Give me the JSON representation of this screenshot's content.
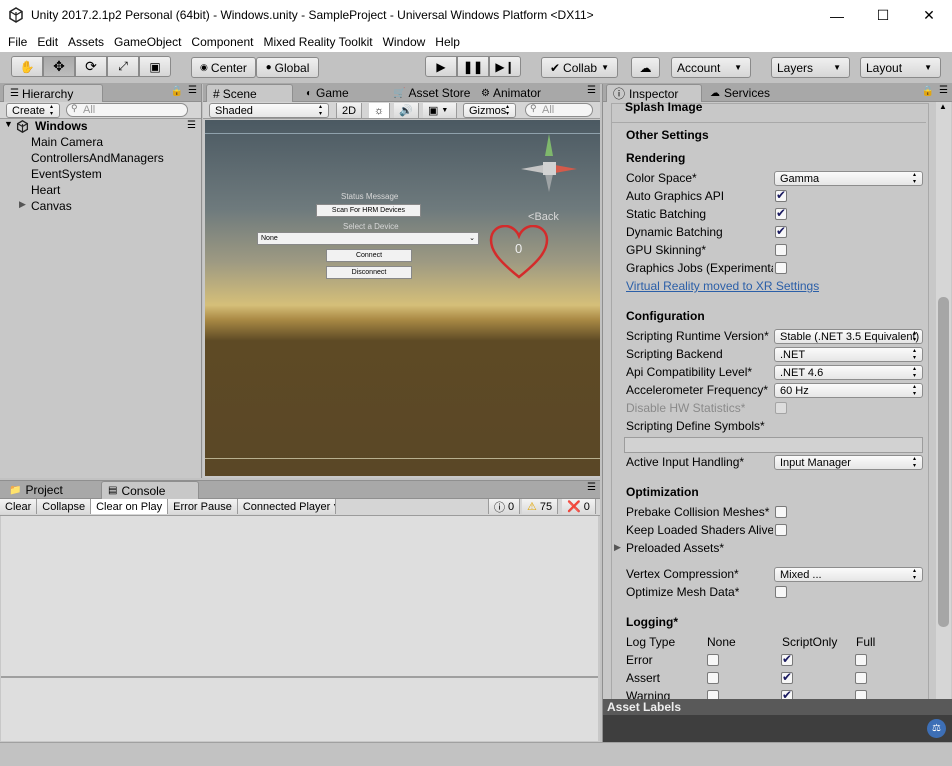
{
  "window": {
    "title": "Unity 2017.2.1p2 Personal (64bit) - Windows.unity - SampleProject - Universal Windows Platform <DX11>",
    "min": "—",
    "max": "☐",
    "close": "✕"
  },
  "menu": [
    "File",
    "Edit",
    "Assets",
    "GameObject",
    "Component",
    "Mixed Reality Toolkit",
    "Window",
    "Help"
  ],
  "toolbar": {
    "center": "Center",
    "global": "Global",
    "collab": "Collab",
    "account": "Account",
    "layers": "Layers",
    "layout": "Layout"
  },
  "hierarchy": {
    "tab": "Hierarchy",
    "create": "Create",
    "search_placeholder": "All",
    "scene": "Windows",
    "items": [
      "Main Camera",
      "ControllersAndManagers",
      "EventSystem",
      "Heart",
      "Canvas"
    ]
  },
  "scene_tabs": {
    "scene": "Scene",
    "game": "Game",
    "asset_store": "Asset Store",
    "animator": "Animator"
  },
  "scene_toolbar": {
    "shaded": "Shaded",
    "two_d": "2D",
    "gizmos": "Gizmos",
    "search_placeholder": "All"
  },
  "scene_view": {
    "status": "Status Message",
    "scan_button": "Scan For HRM Devices",
    "select_label": "Select a Device",
    "select_value": "None",
    "connect": "Connect",
    "disconnect": "Disconnect",
    "heart_value": "0",
    "back": "Back"
  },
  "bottom_tabs": {
    "project": "Project",
    "console": "Console"
  },
  "console_toolbar": {
    "clear": "Clear",
    "collapse": "Collapse",
    "clear_on_play": "Clear on Play",
    "error_pause": "Error Pause",
    "connected_player": "Connected Player",
    "info_count": "0",
    "warn_count": "75",
    "error_count": "0"
  },
  "inspector": {
    "tab": "Inspector",
    "services_tab": "Services",
    "splash_image": "Splash Image",
    "other_settings": "Other Settings",
    "rendering": "Rendering",
    "color_space_label": "Color Space*",
    "color_space_value": "Gamma",
    "auto_graphics_api": "Auto Graphics API",
    "static_batching": "Static Batching",
    "dynamic_batching": "Dynamic Batching",
    "gpu_skinning": "GPU Skinning*",
    "graphics_jobs": "Graphics Jobs (Experimental)*",
    "vr_link": "Virtual Reality moved to XR Settings",
    "configuration": "Configuration",
    "scripting_runtime_label": "Scripting Runtime Version*",
    "scripting_runtime_value": "Stable (.NET 3.5 Equivalent)",
    "scripting_backend_label": "Scripting Backend",
    "scripting_backend_value": ".NET",
    "api_compat_label": "Api Compatibility Level*",
    "api_compat_value": ".NET 4.6",
    "accel_label": "Accelerometer Frequency*",
    "accel_value": "60 Hz",
    "disable_hw_stats": "Disable HW Statistics*",
    "define_symbols": "Scripting Define Symbols*",
    "active_input_label": "Active Input Handling*",
    "active_input_value": "Input Manager",
    "optimization": "Optimization",
    "prebake": "Prebake Collision Meshes*",
    "keep_shaders": "Keep Loaded Shaders Alive*",
    "preloaded_assets": "Preloaded Assets*",
    "vertex_compression_label": "Vertex Compression*",
    "vertex_compression_value": "Mixed ...",
    "optimize_mesh": "Optimize Mesh Data*",
    "logging": "Logging*",
    "log_type": "Log Type",
    "none": "None",
    "script_only": "ScriptOnly",
    "full": "Full",
    "log_rows": [
      "Error",
      "Assert",
      "Warning"
    ],
    "asset_labels": "Asset Labels"
  },
  "colors": {
    "accent": "#3d6fb6",
    "link": "#2b5fa8",
    "heart": "#d42b2b"
  }
}
